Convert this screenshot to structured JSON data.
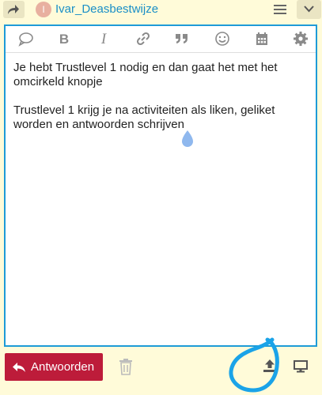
{
  "header": {
    "avatar_letter": "I",
    "username": "Ivar_Deasbestwijze"
  },
  "toolbar": {
    "bold": "B",
    "italic": "I",
    "icons": [
      "quote-bubble-icon",
      "bold-icon",
      "italic-icon",
      "link-icon",
      "blockquote-icon",
      "emoji-icon",
      "calendar-icon",
      "gear-icon"
    ]
  },
  "editor": {
    "paragraph1": "Je hebt Trustlevel 1 nodig en dan gaat het met het omcirkeld knopje",
    "paragraph2": "Trustlevel 1 krijg je na activiteiten als liken, geliket worden en antwoorden schrijven"
  },
  "footer": {
    "reply_label": "Antwoorden"
  },
  "colors": {
    "accent": "#1e9bd7",
    "reply_button": "#bd1c3a",
    "background": "#fffbd9",
    "annotation_circle": "#1aa3e8"
  }
}
